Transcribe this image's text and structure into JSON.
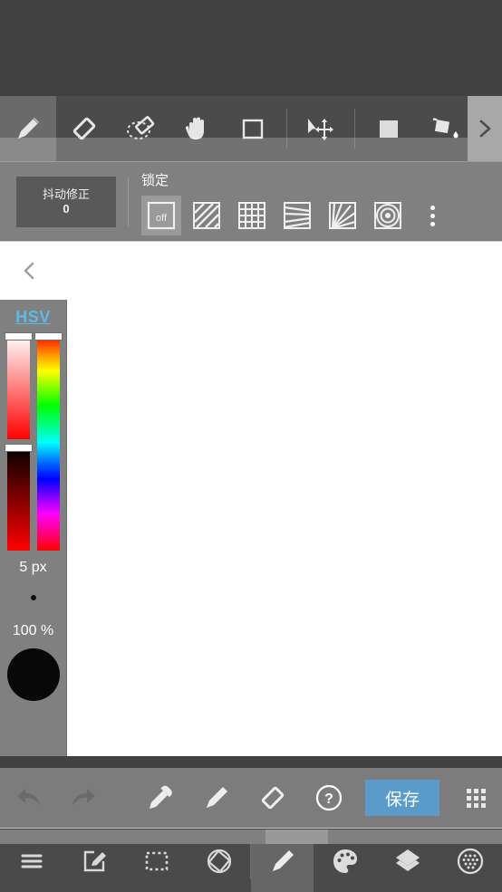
{
  "app": {
    "accent_blue": "#5b9bcb",
    "hsv_link_color": "#5cb9eb",
    "toolbar_bg": "#4b4b4c",
    "options_bg": "#808080",
    "canvas_bg": "#ffffff"
  },
  "toolbar_primary": {
    "tools": [
      {
        "name": "pencil-tool",
        "label": "Pencil",
        "active": true
      },
      {
        "name": "eraser-tool",
        "label": "Eraser",
        "active": false
      },
      {
        "name": "lasso-eraser-tool",
        "label": "Selection Eraser",
        "active": false
      },
      {
        "name": "hand-tool",
        "label": "Pan",
        "active": false
      },
      {
        "name": "rectangle-tool",
        "label": "Rectangle",
        "active": false
      },
      {
        "name": "move-tool",
        "label": "Select and Move",
        "active": false
      },
      {
        "name": "fill-square-tool",
        "label": "Fill Shape",
        "active": false
      },
      {
        "name": "bucket-tool",
        "label": "Paint Bucket",
        "active": false
      }
    ],
    "scroll_right_label": "›"
  },
  "toolbar_secondary": {
    "stabilizer": {
      "label": "抖动修正",
      "value": "0"
    },
    "lock_label": "锁定",
    "symmetry": [
      {
        "name": "symmetry-off",
        "label": "off",
        "selected": true
      },
      {
        "name": "symmetry-diagonal-lines",
        "label": "Diagonal Ruler",
        "selected": false
      },
      {
        "name": "symmetry-grid",
        "label": "Grid Ruler",
        "selected": false
      },
      {
        "name": "symmetry-horizontal-perspective",
        "label": "1-Point Perspective",
        "selected": false
      },
      {
        "name": "symmetry-radial-fan",
        "label": "Fan Perspective",
        "selected": false
      },
      {
        "name": "symmetry-concentric-circles",
        "label": "Concentric Circles",
        "selected": false
      }
    ],
    "more_menu_label": "More options"
  },
  "canvas": {
    "collapse_label": "‹",
    "background": "#ffffff"
  },
  "color_panel": {
    "mode_label": "HSV",
    "sliders": {
      "saturation": {
        "name": "saturation-slider",
        "handle_percent": 0
      },
      "value": {
        "name": "value-slider",
        "handle_percent": 0
      },
      "hue": {
        "name": "hue-slider",
        "handle_percent": 0
      }
    },
    "brush_size": "5 px",
    "opacity": "100 %",
    "current_color": "#080808"
  },
  "actionbar": {
    "items": [
      {
        "name": "undo-button",
        "label": "Undo",
        "disabled": true
      },
      {
        "name": "redo-button",
        "label": "Redo",
        "disabled": true
      },
      {
        "name": "eyedropper-button",
        "label": "Color Picker",
        "disabled": false
      },
      {
        "name": "pencil-button",
        "label": "Pencil",
        "disabled": false
      },
      {
        "name": "eraser-button",
        "label": "Eraser",
        "disabled": false
      },
      {
        "name": "help-button",
        "label": "Help",
        "disabled": false
      }
    ],
    "save_label": "保存",
    "apps_label": "More"
  },
  "navbar": {
    "items": [
      {
        "name": "nav-menu",
        "label": "Menu",
        "active": false
      },
      {
        "name": "nav-edit",
        "label": "Edit",
        "active": false
      },
      {
        "name": "nav-select",
        "label": "Select",
        "active": false
      },
      {
        "name": "nav-rotate",
        "label": "Rotate Canvas",
        "active": false
      },
      {
        "name": "nav-brush",
        "label": "Brush",
        "active": true
      },
      {
        "name": "nav-palette",
        "label": "Color Palette",
        "active": false
      },
      {
        "name": "nav-layers",
        "label": "Layers",
        "active": false
      },
      {
        "name": "nav-material",
        "label": "Materials",
        "active": false
      }
    ]
  }
}
